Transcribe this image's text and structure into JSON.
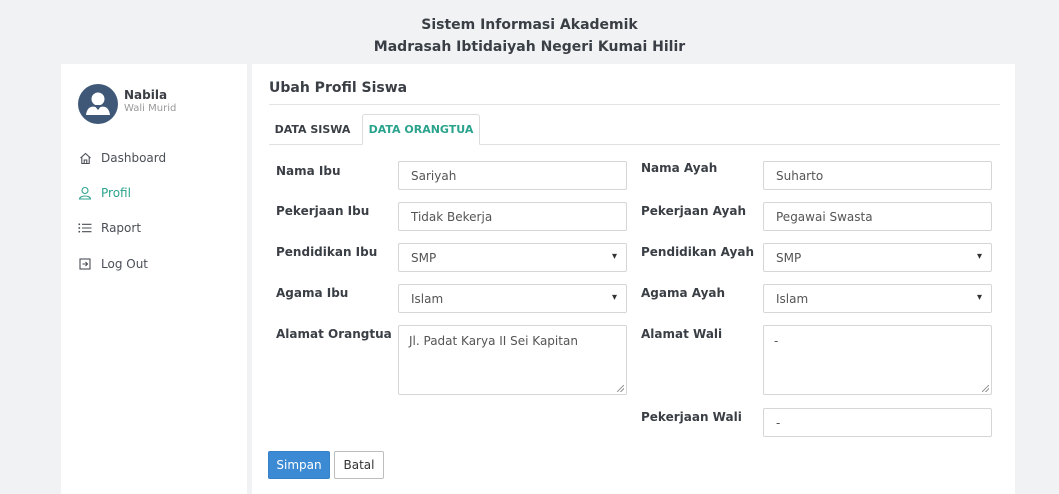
{
  "header": {
    "line1": "Sistem Informasi Akademik",
    "line2": "Madrasah Ibtidaiyah Negeri Kumai Hilir"
  },
  "user": {
    "name": "Nabila",
    "role": "Wali Murid"
  },
  "nav": {
    "items": [
      {
        "label": "Dashboard",
        "icon": "home-icon"
      },
      {
        "label": "Profil",
        "icon": "user-icon",
        "active": true
      },
      {
        "label": "Raport",
        "icon": "list-icon"
      },
      {
        "label": "Log Out",
        "icon": "logout-icon"
      }
    ]
  },
  "panel": {
    "title": "Ubah Profil Siswa",
    "tabs": [
      "DATA SISWA",
      "DATA ORANGTUA"
    ],
    "active_tab": "DATA ORANGTUA"
  },
  "form": {
    "nama_ibu": {
      "label": "Nama Ibu",
      "value": "Sariyah"
    },
    "nama_ayah": {
      "label": "Nama Ayah",
      "value": "Suharto"
    },
    "pekerjaan_ibu": {
      "label": "Pekerjaan Ibu",
      "value": "Tidak Bekerja"
    },
    "pekerjaan_ayah": {
      "label": "Pekerjaan Ayah",
      "value": "Pegawai Swasta"
    },
    "pendidikan_ibu": {
      "label": "Pendidikan Ibu",
      "value": "SMP"
    },
    "pendidikan_ayah": {
      "label": "Pendidikan Ayah",
      "value": "SMP"
    },
    "agama_ibu": {
      "label": "Agama Ibu",
      "value": "Islam"
    },
    "agama_ayah": {
      "label": "Agama Ayah",
      "value": "Islam"
    },
    "alamat_orangtua": {
      "label": "Alamat Orangtua",
      "value": "Jl. Padat Karya II Sei Kapitan"
    },
    "alamat_wali": {
      "label": "Alamat Wali",
      "value": "-"
    },
    "pekerjaan_wali": {
      "label": "Pekerjaan Wali",
      "value": "-"
    }
  },
  "buttons": {
    "save": "Simpan",
    "cancel": "Batal"
  },
  "colors": {
    "accent": "#2aa38d",
    "primary_button": "#3b8ad3",
    "avatar_bg": "#3f5877"
  }
}
